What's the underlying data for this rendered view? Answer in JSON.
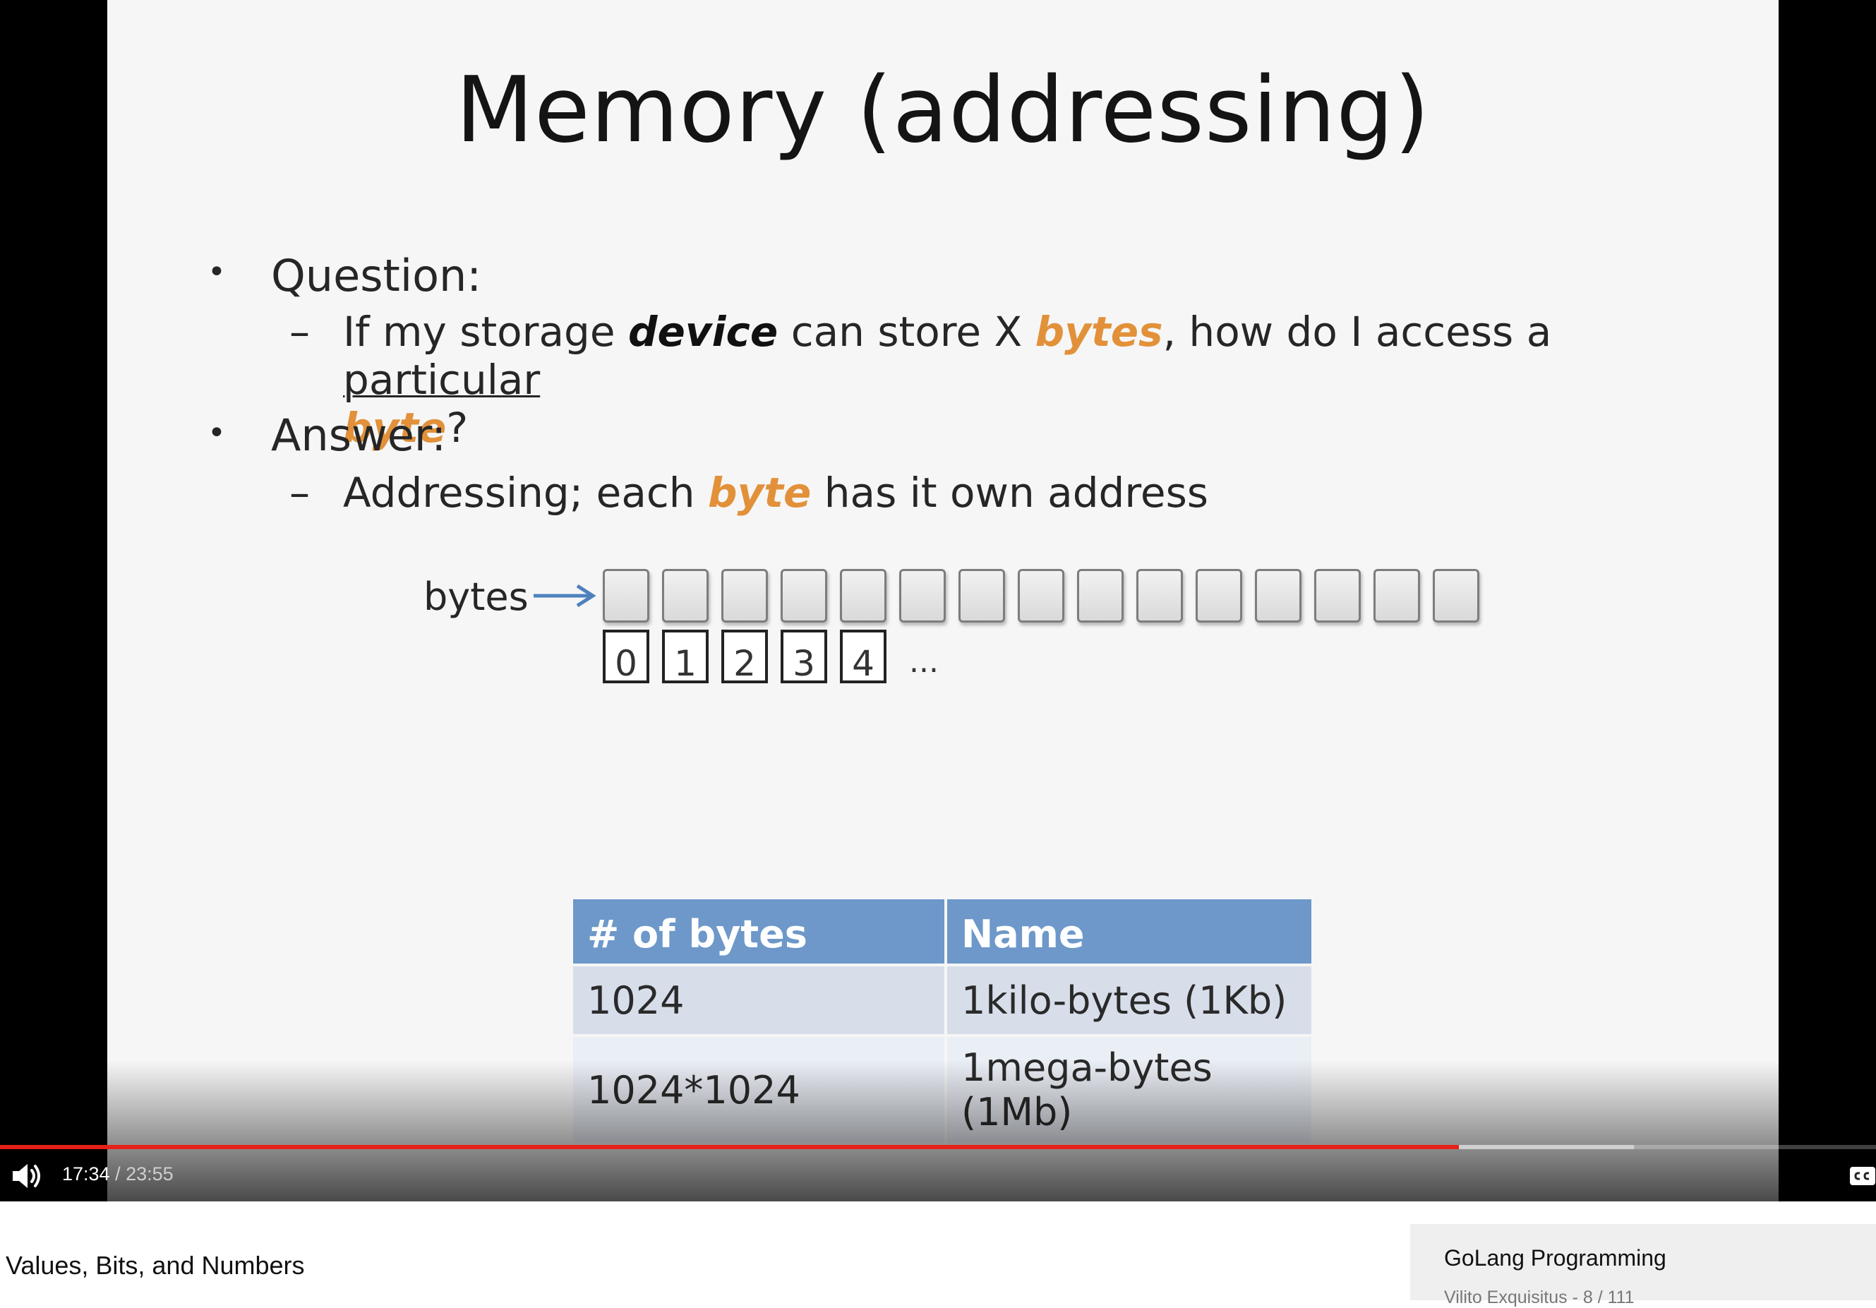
{
  "slide": {
    "title": "Memory (addressing)",
    "bullets": [
      {
        "label": "Question:"
      },
      {
        "label": "Answer:"
      }
    ],
    "question_sub": {
      "dash": "–",
      "p1": "If my storage ",
      "device": "device",
      "p2": " can store X ",
      "bytes": "bytes",
      "p3": ", how do I access a ",
      "particular": "particular",
      "byte": "byte",
      "p4": "?"
    },
    "answer_sub": {
      "dash": "–",
      "p1": "Addressing; each ",
      "byte": "byte",
      "p2": " has it own address"
    },
    "diagram": {
      "bytes_label": "bytes",
      "cell_count": 15,
      "addresses": [
        "0",
        "1",
        "2",
        "3",
        "4"
      ],
      "ellipsis": "..."
    },
    "table": {
      "headers": [
        "# of bytes",
        "Name"
      ],
      "rows": [
        [
          "1024",
          "1kilo-bytes (1Kb)"
        ],
        [
          "1024*1024",
          "1mega-bytes (1Mb)"
        ]
      ]
    }
  },
  "player": {
    "time_current": "17:34",
    "time_separator": " / ",
    "time_total": "23:55",
    "progress_played": 0.7777,
    "progress_buffered": 0.871,
    "volume_icon": "volume-icon",
    "cc_icon": "closed-captions-icon",
    "accent_color": "#e62117"
  },
  "video": {
    "title": "- Values, Bits, and Numbers"
  },
  "playlist": {
    "title": "GoLang Programming",
    "meta": "Vilito Exquisitus - 8 / 111"
  }
}
